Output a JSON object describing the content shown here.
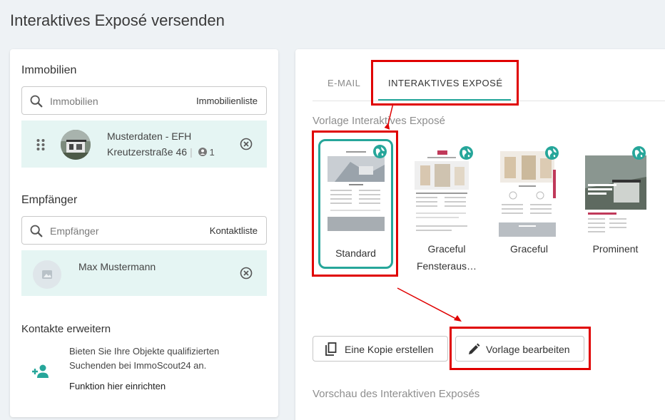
{
  "page_title": "Interaktives Exposé versenden",
  "left": {
    "properties": {
      "title": "Immobilien",
      "search_placeholder": "Immobilien",
      "list_link": "Immobilienliste",
      "item": {
        "name": "Musterdaten - EFH",
        "address": "Kreutzerstraße 46",
        "count": "1"
      }
    },
    "recipients": {
      "title": "Empfänger",
      "search_placeholder": "Empfänger",
      "list_link": "Kontaktliste",
      "contact": {
        "name": "Max Mustermann"
      }
    },
    "expand": {
      "title": "Kontakte erweitern",
      "line1": "Bieten Sie Ihre Objekte qualifizierten",
      "line2": "Suchenden bei ImmoScout24 an.",
      "link": "Funktion hier einrichten"
    }
  },
  "right": {
    "tabs": [
      {
        "label": "E-MAIL"
      },
      {
        "label": "INTERAKTIVES EXPOSÉ",
        "active": true
      }
    ],
    "template_heading": "Vorlage Interaktives Exposé",
    "templates": [
      {
        "label": "Standard",
        "selected": true
      },
      {
        "label": "Graceful Fensteraus…"
      },
      {
        "label": "Graceful"
      },
      {
        "label": "Prominent"
      }
    ],
    "buttons": {
      "copy": "Eine Kopie erstellen",
      "edit": "Vorlage bearbeiten"
    },
    "preview_heading": "Vorschau des Interaktiven Exposés"
  },
  "colors": {
    "accent": "#26a69a",
    "highlight": "#e00000",
    "item_bg": "#e5f5f3"
  }
}
